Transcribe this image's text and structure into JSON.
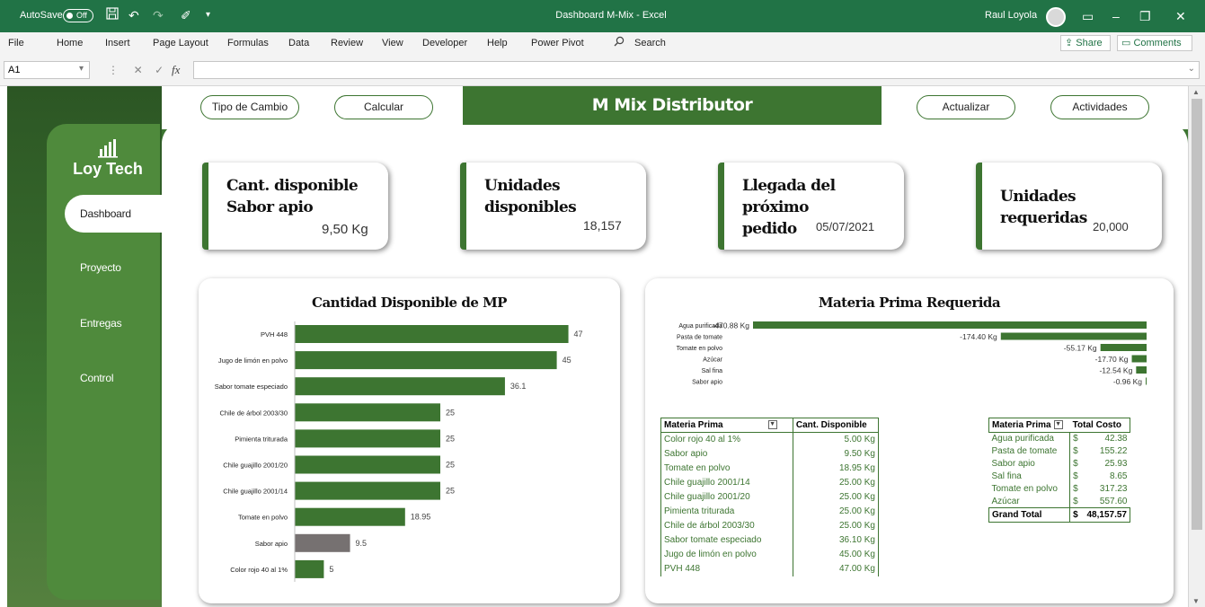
{
  "titlebar": {
    "autosave_label": "AutoSave",
    "autosave_state": "Off",
    "title": "Dashboard M-Mix  -  Excel",
    "user": "Raul Loyola"
  },
  "menu": [
    "File",
    "Home",
    "Insert",
    "Page Layout",
    "Formulas",
    "Data",
    "Review",
    "View",
    "Developer",
    "Help",
    "Power Pivot"
  ],
  "search_placeholder": "Search",
  "share_label": "Share",
  "comments_label": "Comments",
  "formula": {
    "cell_ref": "A1",
    "fx": "fx",
    "value": ""
  },
  "sidebar": {
    "logo_text": "Loy Tech",
    "items": [
      "Dashboard",
      "Proyecto",
      "Entregas",
      "Control"
    ],
    "active": "Dashboard"
  },
  "buttons": {
    "tipo_cambio": "Tipo de Cambio",
    "calcular": "Calcular",
    "actualizar": "Actualizar",
    "actividades": "Actividades"
  },
  "banner_title": "M Mix Distributor",
  "kpis": [
    {
      "label_line1": "Cant. disponible",
      "label_line2": "Sabor apio",
      "value": "9,50 Kg"
    },
    {
      "label_line1": "Unidades",
      "label_line2": "disponibles",
      "value": "18,157"
    },
    {
      "label_line1": "Llegada del próximo",
      "label_line2": "pedido",
      "value": "05/07/2021"
    },
    {
      "label_line1": "Unidades requeridas",
      "label_line2": "",
      "value": "20,000"
    }
  ],
  "colors": {
    "green": "#3d7531",
    "highlight_bar": "#767171"
  },
  "chart_data": [
    {
      "type": "bar",
      "orientation": "horizontal",
      "title": "Cantidad Disponible de MP",
      "categories": [
        "PVH 448",
        "Jugo de limón en polvo",
        "Sabor tomate especiado",
        "Chile de árbol 2003/30",
        "Pimienta triturada",
        "Chile guajillo 2001/20",
        "Chile guajillo 2001/14",
        "Tomate en polvo",
        "Sabor apio",
        "Color rojo 40 al 1%"
      ],
      "values": [
        47,
        45,
        36.1,
        25,
        25,
        25,
        25,
        18.95,
        9.5,
        5
      ],
      "data_labels": [
        "47",
        "45",
        "36.1",
        "25",
        "25",
        "25",
        "25",
        "18.95",
        "9.5",
        "5"
      ],
      "highlight_category": "Sabor apio",
      "xlim": [
        0,
        50
      ],
      "grid": false
    },
    {
      "type": "bar",
      "orientation": "horizontal",
      "title": "Materia Prima Requerida",
      "categories": [
        "Agua purificada",
        "Pasta de tomate",
        "Tomate en polvo",
        "Azúcar",
        "Sal fina",
        "Sabor apio"
      ],
      "values": [
        -470.88,
        -174.4,
        -55.17,
        -17.7,
        -12.54,
        -0.96
      ],
      "data_labels": [
        "-470.88 Kg",
        "-174.40 Kg",
        "-55.17 Kg",
        "-17.70 Kg",
        "-12.54 Kg",
        "-0.96 Kg"
      ],
      "xlim": [
        -470.88,
        0
      ],
      "grid": false
    }
  ],
  "table_disponible": {
    "headers": [
      "Materia Prima",
      "Cant. Disponible"
    ],
    "rows": [
      [
        "Color rojo 40 al 1%",
        "5.00 Kg"
      ],
      [
        "Sabor apio",
        "9.50 Kg"
      ],
      [
        "Tomate en polvo",
        "18.95 Kg"
      ],
      [
        "Chile guajillo 2001/14",
        "25.00 Kg"
      ],
      [
        "Chile guajillo 2001/20",
        "25.00 Kg"
      ],
      [
        "Pimienta triturada",
        "25.00 Kg"
      ],
      [
        "Chile de árbol 2003/30",
        "25.00 Kg"
      ],
      [
        "Sabor tomate especiado",
        "36.10 Kg"
      ],
      [
        "Jugo de limón en polvo",
        "45.00 Kg"
      ],
      [
        "PVH 448",
        "47.00 Kg"
      ]
    ]
  },
  "table_costo": {
    "headers": [
      "Materia Prima",
      "Total Costo"
    ],
    "rows": [
      [
        "Agua purificada",
        "$",
        "42.38"
      ],
      [
        "Pasta de tomate",
        "$",
        "155.22"
      ],
      [
        "Sabor apio",
        "$",
        "25.93"
      ],
      [
        "Sal fina",
        "$",
        "8.65"
      ],
      [
        "Tomate en polvo",
        "$",
        "317.23"
      ],
      [
        "Azúcar",
        "$",
        "557.60"
      ]
    ],
    "total_label": "Grand Total",
    "total_currency": "$",
    "total_value": "48,157.57"
  }
}
